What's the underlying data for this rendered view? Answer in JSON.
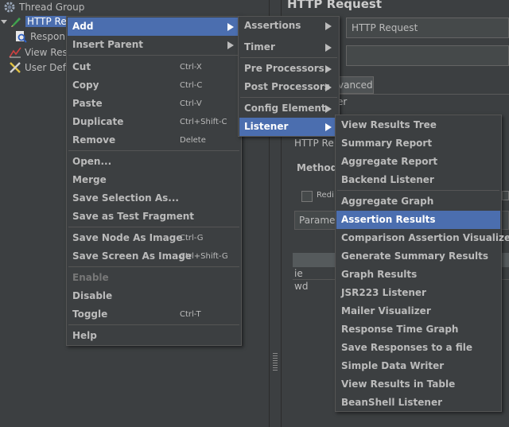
{
  "tree": {
    "items": [
      {
        "label": "Thread Group"
      },
      {
        "label": "HTTP Re"
      },
      {
        "label": "Respon"
      },
      {
        "label": "View Res"
      },
      {
        "label": "User Def"
      }
    ]
  },
  "right_panel": {
    "title": "HTTP Request",
    "name_value": "HTTP Request",
    "comments_value": "",
    "tab_advanced": "vanced",
    "section_label": "er",
    "http_label": "HTTP Re",
    "method_label": "Method:",
    "redirect_label": "Redi",
    "params_header": "Parame",
    "row1": "ie",
    "row2": "wd"
  },
  "context_menu": {
    "items": [
      {
        "label": "Add"
      },
      {
        "label": "Insert Parent"
      },
      {
        "label": "Cut",
        "shortcut": "Ctrl-X"
      },
      {
        "label": "Copy",
        "shortcut": "Ctrl-C"
      },
      {
        "label": "Paste",
        "shortcut": "Ctrl-V"
      },
      {
        "label": "Duplicate",
        "shortcut": "Ctrl+Shift-C"
      },
      {
        "label": "Remove",
        "shortcut": "Delete"
      },
      {
        "label": "Open..."
      },
      {
        "label": "Merge"
      },
      {
        "label": "Save Selection As..."
      },
      {
        "label": "Save as Test Fragment"
      },
      {
        "label": "Save Node As Image",
        "shortcut": "Ctrl-G"
      },
      {
        "label": "Save Screen As Image",
        "shortcut": "Ctrl+Shift-G"
      },
      {
        "label": "Enable"
      },
      {
        "label": "Disable"
      },
      {
        "label": "Toggle",
        "shortcut": "Ctrl-T"
      },
      {
        "label": "Help"
      }
    ]
  },
  "add_menu": {
    "items": [
      {
        "label": "Assertions"
      },
      {
        "label": "Timer"
      },
      {
        "label": "Pre Processors"
      },
      {
        "label": "Post Processors"
      },
      {
        "label": "Config Element"
      },
      {
        "label": "Listener"
      }
    ]
  },
  "listener_menu": {
    "items": [
      {
        "label": "View Results Tree"
      },
      {
        "label": "Summary Report"
      },
      {
        "label": "Aggregate Report"
      },
      {
        "label": "Backend Listener"
      },
      {
        "label": "Aggregate Graph"
      },
      {
        "label": "Assertion Results"
      },
      {
        "label": "Comparison Assertion Visualizer"
      },
      {
        "label": "Generate Summary Results"
      },
      {
        "label": "Graph Results"
      },
      {
        "label": "JSR223 Listener"
      },
      {
        "label": "Mailer Visualizer"
      },
      {
        "label": "Response Time Graph"
      },
      {
        "label": "Save Responses to a file"
      },
      {
        "label": "Simple Data Writer"
      },
      {
        "label": "View Results in Table"
      },
      {
        "label": "BeanShell Listener"
      }
    ]
  },
  "colors": {
    "background": "#3c3f41",
    "highlight": "#4b6eaf",
    "text": "#bbbbbb"
  }
}
